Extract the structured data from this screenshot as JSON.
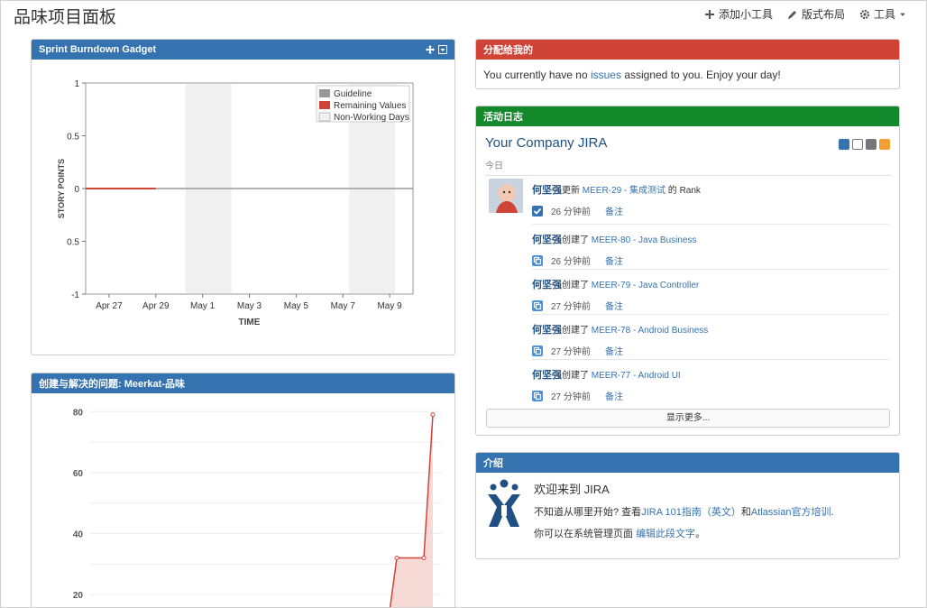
{
  "page": {
    "title": "品味项目面板"
  },
  "toolbar": {
    "add_gadget": "添加小工具",
    "edit_layout": "版式布局",
    "tools": "工具"
  },
  "burndown": {
    "title": "Sprint Burndown Gadget",
    "legend": [
      "Guideline",
      "Remaining Values",
      "Non-Working Days"
    ],
    "colors": {
      "guideline": "#999999",
      "remaining": "#d04437",
      "nonworking": "#f0f0f0"
    }
  },
  "created": {
    "title": "创建与解决的问题: Meerkat-品味"
  },
  "assigned": {
    "title": "分配给我的",
    "msg_before": "You currently have no ",
    "msg_link": "issues",
    "msg_after": " assigned to you. Enjoy your day!"
  },
  "activity": {
    "title": "活动日志",
    "stream_title": "Your Company JIRA",
    "today": "今日",
    "entries": [
      {
        "user": "何坚强",
        "action": "更新",
        "issue": "MEER-29 - 集成测试",
        "suffix": "的 Rank",
        "time": "26 分钟前",
        "comment": "备注",
        "icon": "check-icon"
      },
      {
        "user": "何坚强",
        "action": "创建了",
        "issue": "MEER-80 - Java Business",
        "suffix": "",
        "time": "26 分钟前",
        "comment": "备注",
        "icon": "subtask-icon"
      },
      {
        "user": "何坚强",
        "action": "创建了",
        "issue": "MEER-79 - Java Controller",
        "suffix": "",
        "time": "27 分钟前",
        "comment": "备注",
        "icon": "subtask-icon"
      },
      {
        "user": "何坚强",
        "action": "创建了",
        "issue": "MEER-78 - Android Business",
        "suffix": "",
        "time": "27 分钟前",
        "comment": "备注",
        "icon": "subtask-icon"
      },
      {
        "user": "何坚强",
        "action": "创建了",
        "issue": "MEER-77 - Android UI",
        "suffix": "",
        "time": "27 分钟前",
        "comment": "备注",
        "icon": "subtask-icon"
      }
    ],
    "more": "显示更多..."
  },
  "intro": {
    "title": "介绍",
    "welcome": "欢迎来到 JIRA",
    "line2_before": "不知道从哪里开始? 查看",
    "line2_link1": "JIRA 101指南（英文）",
    "line2_mid": "和",
    "line2_link2": "Atlassian官方培训",
    "line2_after": ".",
    "line3_before": "你可以在系统管理页面 ",
    "line3_link": "编辑此段文字",
    "line3_after": "。"
  },
  "chart_data": [
    {
      "type": "line",
      "title": "",
      "xlabel": "TIME",
      "ylabel": "STORY POINTS",
      "x_ticks": [
        "Apr 27",
        "Apr 29",
        "May 1",
        "May 3",
        "May 5",
        "May 7",
        "May 9"
      ],
      "y_ticks": [
        "1",
        "0.5",
        "0",
        "0.5",
        "-1"
      ],
      "ylim": [
        -1,
        1
      ],
      "series": [
        {
          "name": "Guideline",
          "x": [
            "Apr 26",
            "May 10"
          ],
          "values": [
            0,
            0
          ]
        },
        {
          "name": "Remaining Values",
          "x": [
            "Apr 26",
            "Apr 29"
          ],
          "values": [
            0,
            0
          ]
        }
      ],
      "non_working_days": [
        [
          "Apr 30",
          "May 2"
        ],
        [
          "May 7",
          "May 9"
        ]
      ],
      "legend_position": "top-right"
    },
    {
      "type": "area",
      "y_ticks": [
        80,
        60,
        40,
        20
      ],
      "ylim": [
        15,
        86
      ],
      "series": [
        {
          "points": [
            [
              0,
              0
            ],
            [
              33,
              0
            ],
            [
              34,
              32
            ],
            [
              37,
              32
            ],
            [
              38,
              79
            ]
          ]
        }
      ]
    }
  ]
}
